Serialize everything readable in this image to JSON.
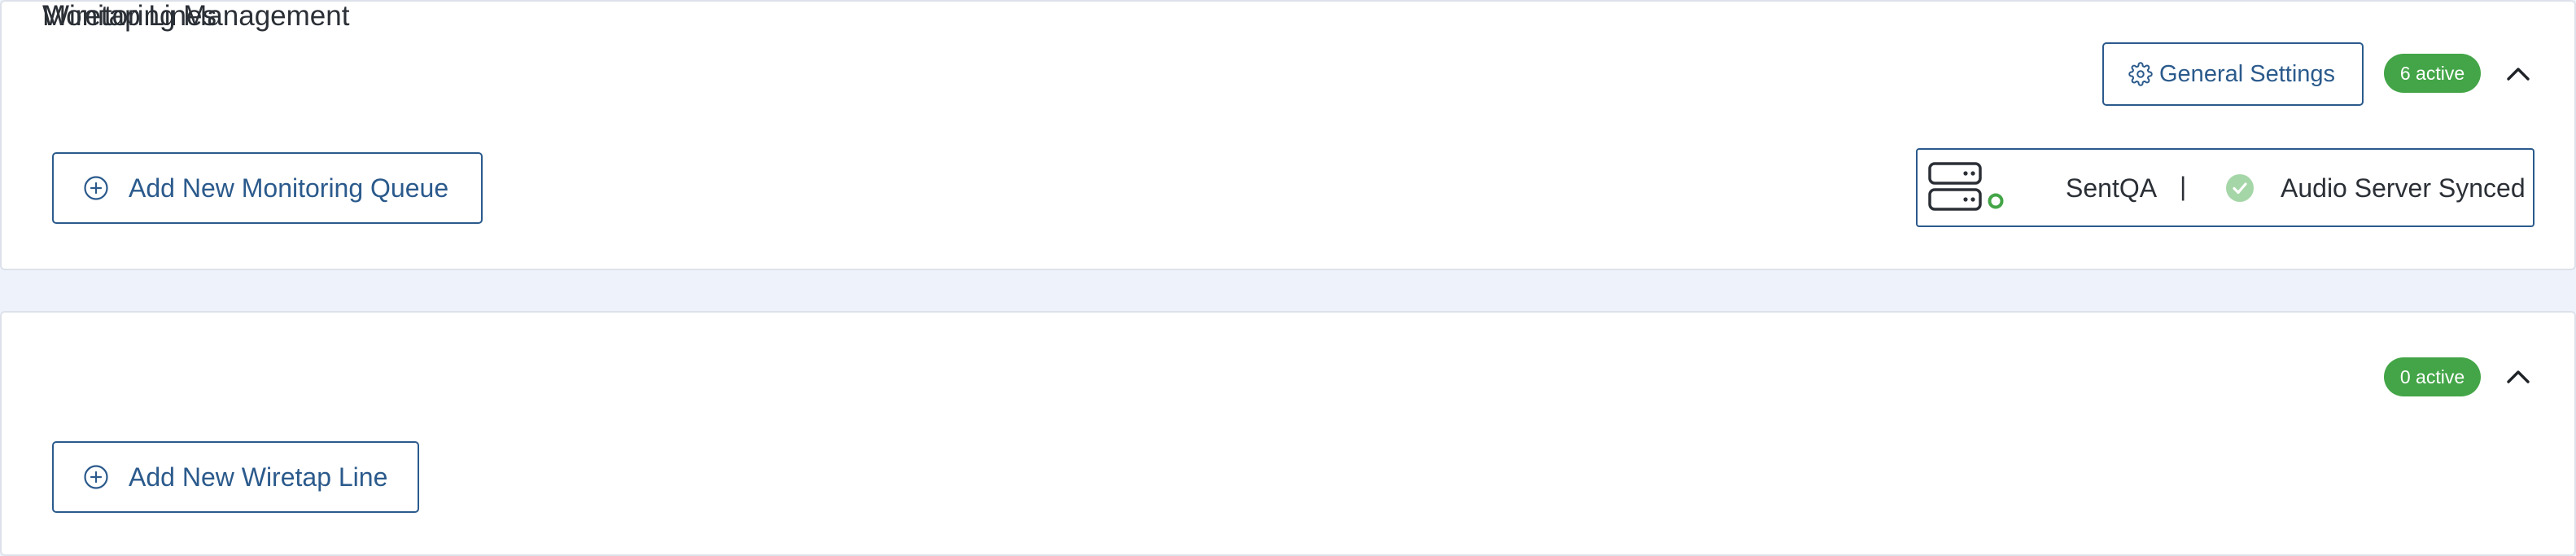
{
  "monitoring": {
    "title": "Monitoring Management",
    "general_settings_label": "General Settings",
    "settings_icon": "gear-icon",
    "active_badge": "6 active",
    "collapse_icon": "chevron-up-icon",
    "add_button_label": "Add New Monitoring Queue",
    "add_icon": "plus-circle-icon",
    "server_status": {
      "server_icon": "server-icon",
      "server_name": "SentQA",
      "separator": "|",
      "sync_icon": "check-circle-icon",
      "sync_label": "Audio Server Synced"
    }
  },
  "wiretap": {
    "title": "Wiretap Lines",
    "active_badge": "0 active",
    "collapse_icon": "chevron-up-icon",
    "add_button_label": "Add New Wiretap Line",
    "add_icon": "plus-circle-icon"
  },
  "colors": {
    "accent": "#2b5a8c",
    "badge_green": "#43a547",
    "sync_green": "#a5d6a7",
    "page_background": "#eef2fb"
  }
}
